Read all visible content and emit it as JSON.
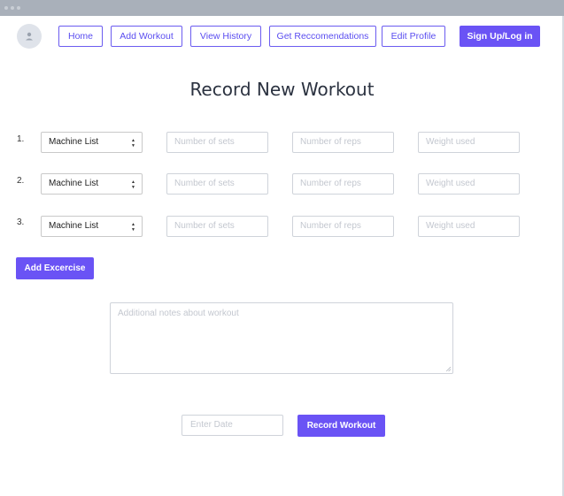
{
  "nav": {
    "home": "Home",
    "add_workout": "Add Workout",
    "view_history": "View History",
    "recommendations": "Get Reccomendations",
    "edit_profile": "Edit Profile",
    "signup": "Sign Up/Log in"
  },
  "page": {
    "title": "Record New Workout"
  },
  "exercises": [
    {
      "number": "1.",
      "machine": "Machine List",
      "sets_placeholder": "Number of sets",
      "reps_placeholder": "Number of reps",
      "weight_placeholder": "Weight used"
    },
    {
      "number": "2.",
      "machine": "Machine List",
      "sets_placeholder": "Number of sets",
      "reps_placeholder": "Number of reps",
      "weight_placeholder": "Weight used"
    },
    {
      "number": "3.",
      "machine": "Machine List",
      "sets_placeholder": "Number of sets",
      "reps_placeholder": "Number of reps",
      "weight_placeholder": "Weight used"
    }
  ],
  "add_exercise_label": "Add Excercise",
  "notes_placeholder": "Additional notes about workout",
  "date_placeholder": "Enter Date",
  "record_label": "Record Workout",
  "colors": {
    "accent": "#6a53f5",
    "border": "#cfd3da",
    "placeholder": "#c3c7cf"
  },
  "icons": {
    "avatar": "user-icon",
    "select": "updown-arrows-icon"
  }
}
